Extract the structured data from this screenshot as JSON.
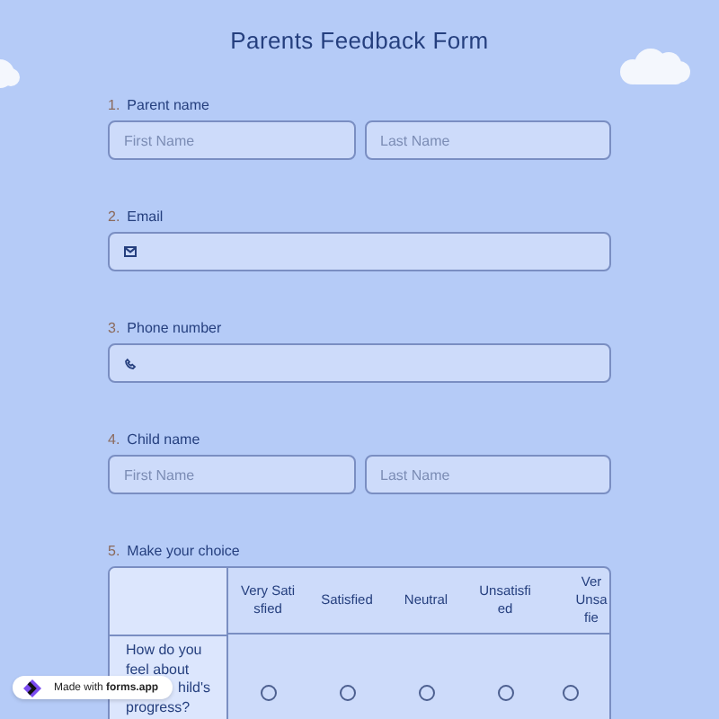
{
  "title": "Parents Feedback Form",
  "questions": [
    {
      "number": "1.",
      "label": "Parent name",
      "kind": "name",
      "fields": [
        {
          "placeholder": "First Name"
        },
        {
          "placeholder": "Last Name"
        }
      ]
    },
    {
      "number": "2.",
      "label": "Email",
      "kind": "email"
    },
    {
      "number": "3.",
      "label": "Phone number",
      "kind": "phone"
    },
    {
      "number": "4.",
      "label": "Child name",
      "kind": "name",
      "fields": [
        {
          "placeholder": "First Name"
        },
        {
          "placeholder": "Last Name"
        }
      ]
    },
    {
      "number": "5.",
      "label": "Make your choice",
      "kind": "matrix",
      "columns": [
        "Very Satisfied",
        "Satisfied",
        "Neutral",
        "Unsatisfied",
        "Ver Unsa fie"
      ],
      "rows": [
        {
          "label_parts": [
            "How do you feel about",
            "hild's",
            "progress?"
          ],
          "choices": [
            {
              "selected": false
            },
            {
              "selected": false
            },
            {
              "selected": false
            },
            {
              "selected": false
            },
            {
              "selected": false
            }
          ]
        }
      ]
    }
  ],
  "badge": {
    "text": "Made with **forms.app**"
  }
}
